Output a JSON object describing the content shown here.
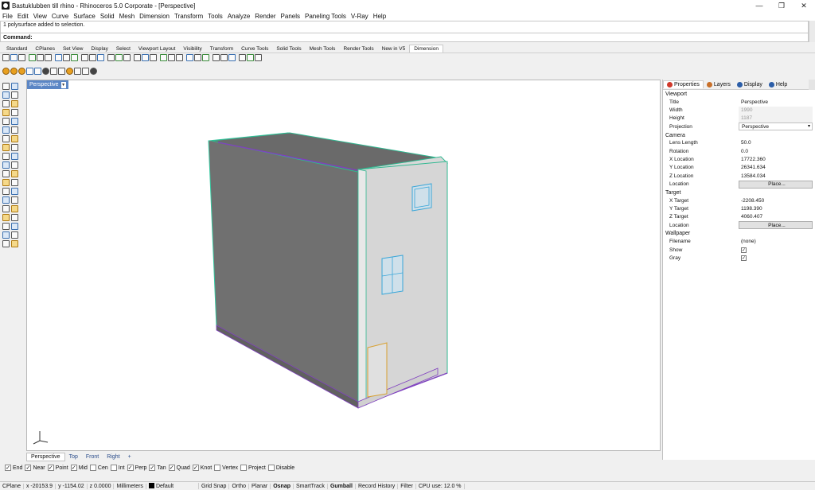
{
  "window": {
    "title": "Bastuklubben till rhino - Rhinoceros  5.0 Corporate - [Perspective]",
    "app_icon": "rhino-icon",
    "controls": [
      "—",
      "❐",
      "✕"
    ]
  },
  "menu": [
    "File",
    "Edit",
    "View",
    "Curve",
    "Surface",
    "Solid",
    "Mesh",
    "Dimension",
    "Transform",
    "Tools",
    "Analyze",
    "Render",
    "Panels",
    "Paneling Tools",
    "V-Ray",
    "Help"
  ],
  "command": {
    "history": "1 polysurface added to selection.",
    "label": "Command:",
    "value": ""
  },
  "toolbar_tabs": [
    "Standard",
    "CPlanes",
    "Set View",
    "Display",
    "Select",
    "Viewport Layout",
    "Visibility",
    "Transform",
    "Curve Tools",
    "Solid Tools",
    "Mesh Tools",
    "Render Tools",
    "New in V5",
    "Dimension"
  ],
  "toolbar_active": "Dimension",
  "viewport": {
    "label": "Perspective"
  },
  "viewport_tabs": [
    "Perspective",
    "Top",
    "Front",
    "Right",
    "+"
  ],
  "osnaps": [
    {
      "label": "End",
      "checked": true
    },
    {
      "label": "Near",
      "checked": true
    },
    {
      "label": "Point",
      "checked": true
    },
    {
      "label": "Mid",
      "checked": true
    },
    {
      "label": "Cen",
      "checked": false
    },
    {
      "label": "Int",
      "checked": false
    },
    {
      "label": "Perp",
      "checked": true
    },
    {
      "label": "Tan",
      "checked": true
    },
    {
      "label": "Quad",
      "checked": true
    },
    {
      "label": "Knot",
      "checked": true
    },
    {
      "label": "Vertex",
      "checked": false
    },
    {
      "label": "Project",
      "checked": false
    },
    {
      "label": "Disable",
      "checked": false
    }
  ],
  "status": {
    "cplane": "CPlane",
    "x": "x -20153.9",
    "y": "y -1154.02",
    "z": "z 0.0000",
    "units": "Millimeters",
    "layer": "Default",
    "grid_snap": "Grid Snap",
    "ortho": "Ortho",
    "planar": "Planar",
    "osnap": "Osnap",
    "smarttrack": "SmartTrack",
    "gumball": "Gumball",
    "record_history": "Record History",
    "filter": "Filter",
    "cpu": "CPU use: 12.0 %"
  },
  "panel": {
    "tabs": [
      {
        "label": "Properties",
        "icon": "properties-icon",
        "color": "#d0392b"
      },
      {
        "label": "Layers",
        "icon": "layers-icon",
        "color": "#c8702a"
      },
      {
        "label": "Display",
        "icon": "display-icon",
        "color": "#2c5ea8"
      },
      {
        "label": "Help",
        "icon": "help-icon",
        "color": "#2c5ea8"
      }
    ],
    "sections": [
      {
        "title": "Viewport",
        "rows": [
          {
            "k": "Title",
            "v": "Perspective",
            "kind": "text"
          },
          {
            "k": "Width",
            "v": "1990",
            "kind": "disabled"
          },
          {
            "k": "Height",
            "v": "1187",
            "kind": "disabled"
          },
          {
            "k": "Projection",
            "v": "Perspective",
            "kind": "select"
          }
        ]
      },
      {
        "title": "Camera",
        "rows": [
          {
            "k": "Lens Length",
            "v": "50.0",
            "kind": "text"
          },
          {
            "k": "Rotation",
            "v": "0.0",
            "kind": "text"
          },
          {
            "k": "X Location",
            "v": "17722.360",
            "kind": "text"
          },
          {
            "k": "Y Location",
            "v": "26341.634",
            "kind": "text"
          },
          {
            "k": "Z Location",
            "v": "13584.034",
            "kind": "text"
          },
          {
            "k": "Location",
            "v": "Place...",
            "kind": "button"
          }
        ]
      },
      {
        "title": "Target",
        "rows": [
          {
            "k": "X Target",
            "v": "-2208.450",
            "kind": "text"
          },
          {
            "k": "Y Target",
            "v": "1198.390",
            "kind": "text"
          },
          {
            "k": "Z Target",
            "v": "4060.407",
            "kind": "text"
          },
          {
            "k": "Location",
            "v": "Place...",
            "kind": "button"
          }
        ]
      },
      {
        "title": "Wallpaper",
        "rows": [
          {
            "k": "Filename",
            "v": "(none)",
            "kind": "text"
          },
          {
            "k": "Show",
            "v": "✓",
            "kind": "check"
          },
          {
            "k": "Gray",
            "v": "✓",
            "kind": "check"
          }
        ]
      }
    ]
  }
}
